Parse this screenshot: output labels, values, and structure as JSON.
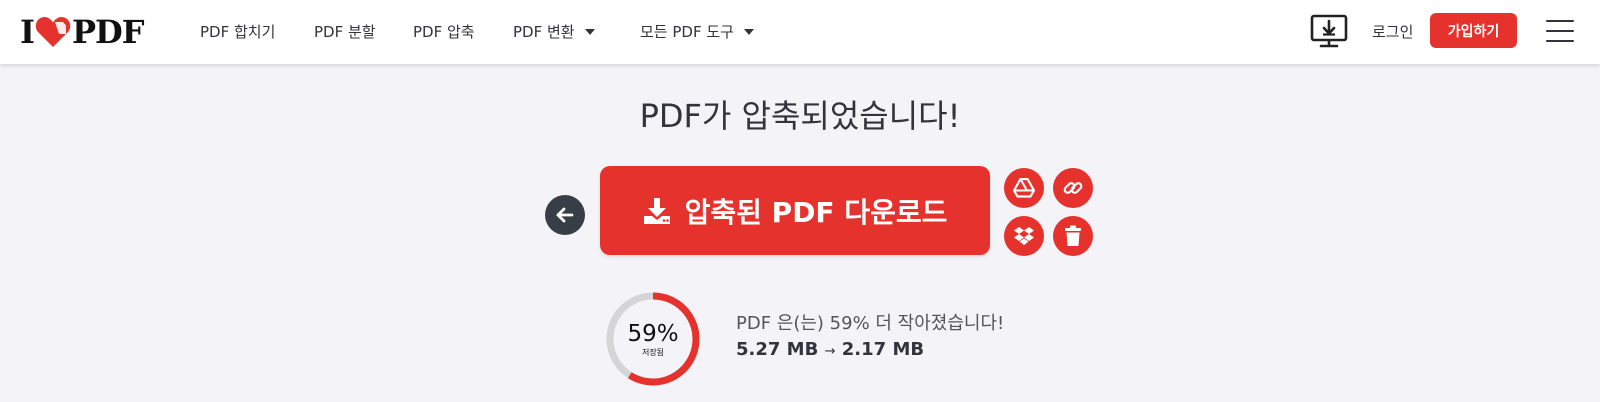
{
  "header": {
    "logo": {
      "left": "I",
      "right": "PDF",
      "heart_color": "#e5322d"
    },
    "nav": [
      {
        "label": "PDF 합치기"
      },
      {
        "label": "PDF 분할"
      },
      {
        "label": "PDF 압축"
      },
      {
        "label": "PDF 변환",
        "dropdown": true
      },
      {
        "label": "모든 PDF 도구",
        "dropdown": true
      }
    ],
    "desktop_app_icon": "monitor-download-icon",
    "login_label": "로그인",
    "signup_label": "가입하기",
    "menu_icon": "hamburger-icon"
  },
  "main": {
    "title": "PDF가 압축되었습니다!",
    "download_label": "압축된 PDF 다운로드",
    "back_icon": "arrow-left-icon",
    "side_actions": [
      {
        "icon": "google-drive-icon"
      },
      {
        "icon": "link-icon"
      },
      {
        "icon": "dropbox-icon"
      },
      {
        "icon": "trash-icon"
      }
    ],
    "result": {
      "percent": "59%",
      "percent_value": 59,
      "saved_label": "저장됨",
      "message": "PDF 은(는) 59% 더 작아졌습니다!",
      "size_before": "5.27 MB",
      "size_after": "2.17 MB"
    }
  },
  "colors": {
    "accent": "#e5322d",
    "text": "#33333b",
    "background": "#f4f3f8",
    "ring_track": "#d5d5d7",
    "back_button": "#383e45"
  }
}
